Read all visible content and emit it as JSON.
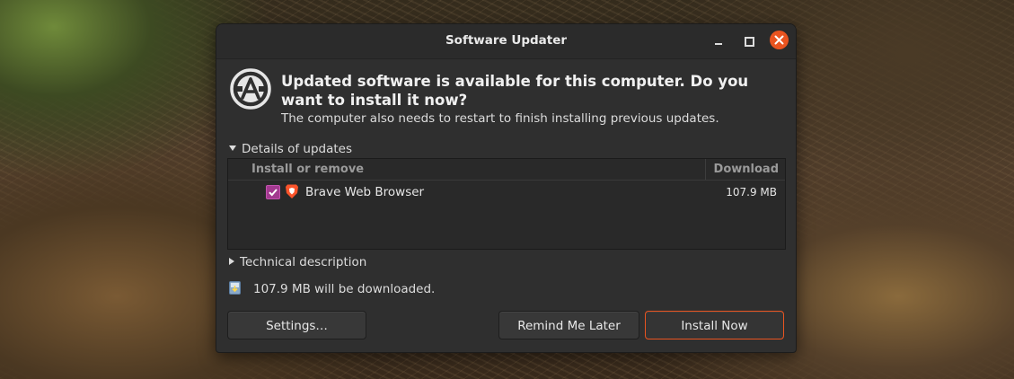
{
  "window": {
    "title": "Software Updater",
    "accent_color": "#e95420"
  },
  "message": {
    "headline": "Updated software is available for this computer. Do you want to install it now?",
    "subline": "The computer also needs to restart to finish installing previous updates."
  },
  "details": {
    "toggle_label": "Details of updates",
    "columns": {
      "install": "Install or remove",
      "download": "Download"
    },
    "rows": [
      {
        "checked": true,
        "icon": "brave-browser-icon",
        "name": "Brave Web Browser",
        "size": "107.9 MB"
      }
    ]
  },
  "technical": {
    "toggle_label": "Technical description"
  },
  "download_summary": "107.9 MB will be downloaded.",
  "buttons": {
    "settings": "Settings…",
    "remind": "Remind Me Later",
    "install": "Install Now"
  }
}
